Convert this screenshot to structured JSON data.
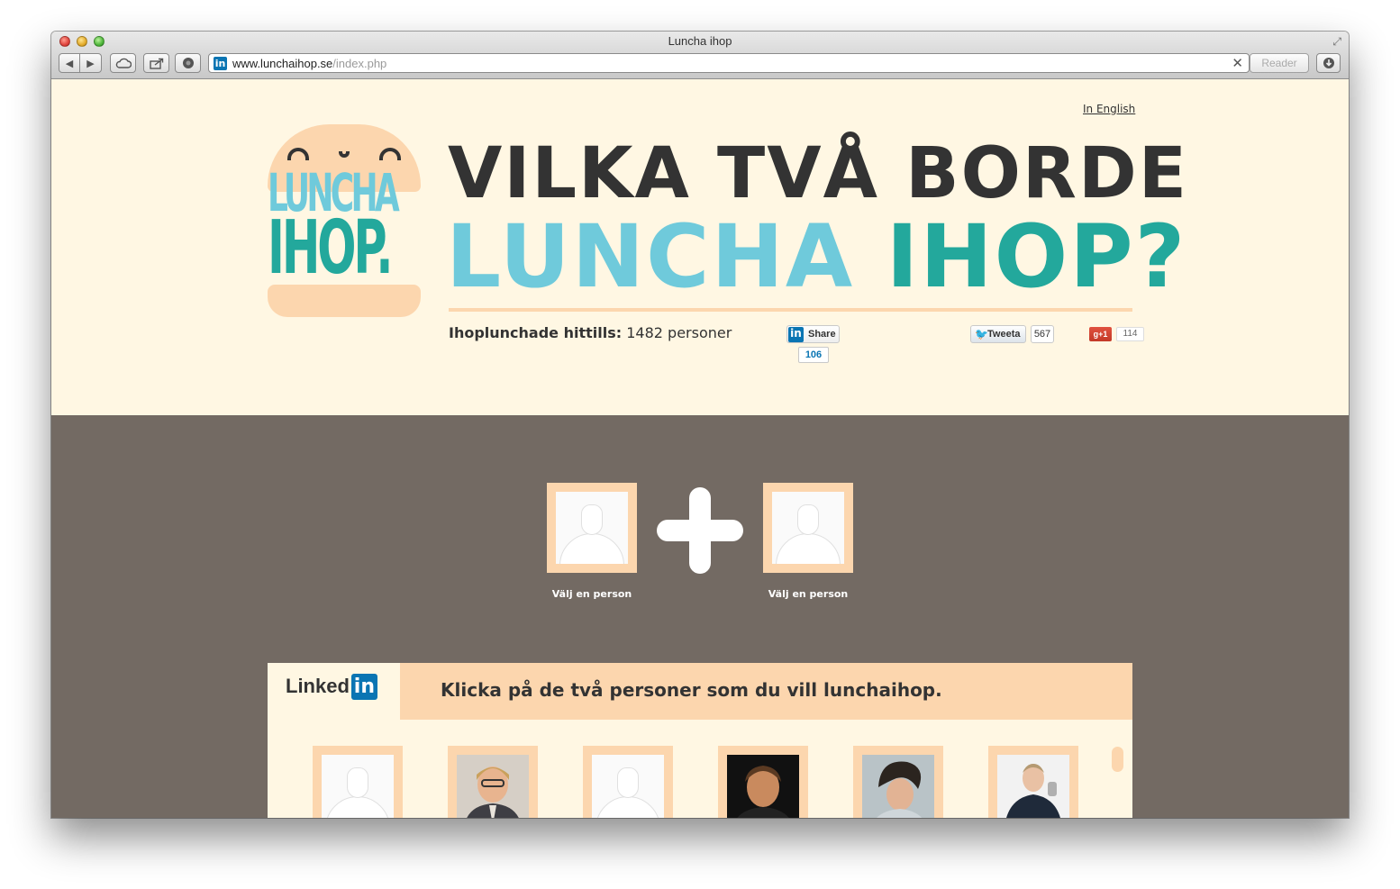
{
  "window": {
    "title": "Luncha ihop"
  },
  "toolbar": {
    "url_host": "www.lunchaihop.se",
    "url_path": "/index.php",
    "reader_label": "Reader",
    "favicon": "in"
  },
  "hero": {
    "in_english": "In English",
    "logo": {
      "line1": "LUNCHA",
      "line2": "IHOP."
    },
    "headline_line1": "VILKA TVÅ BORDE",
    "headline_luncha": "LUNCHA",
    "headline_ihop": "IHOP?",
    "counter_label": "Ihoplunchade hittills:",
    "counter_value": "1482 personer"
  },
  "social": {
    "linkedin_share_label": "Share",
    "linkedin_icon": "in",
    "linkedin_count": "106",
    "tweet_label": "Tweeta",
    "tweet_count": "567",
    "gplus_label": "g+1",
    "gplus_count": "114"
  },
  "picker": {
    "slot1_label": "Välj en person",
    "slot2_label": "Välj en person"
  },
  "panel": {
    "linkedin_word": "Linked",
    "linkedin_in": "in",
    "instruction": "Klicka på de två personer som du vill lunchaihop."
  },
  "colors": {
    "cream": "#fff7e3",
    "peach": "#fcd6ae",
    "light_teal": "#6fcadb",
    "teal": "#23a89c",
    "dark_gray": "#333333",
    "brown_gray": "#736a63",
    "linkedin_blue": "#0a75b3"
  }
}
